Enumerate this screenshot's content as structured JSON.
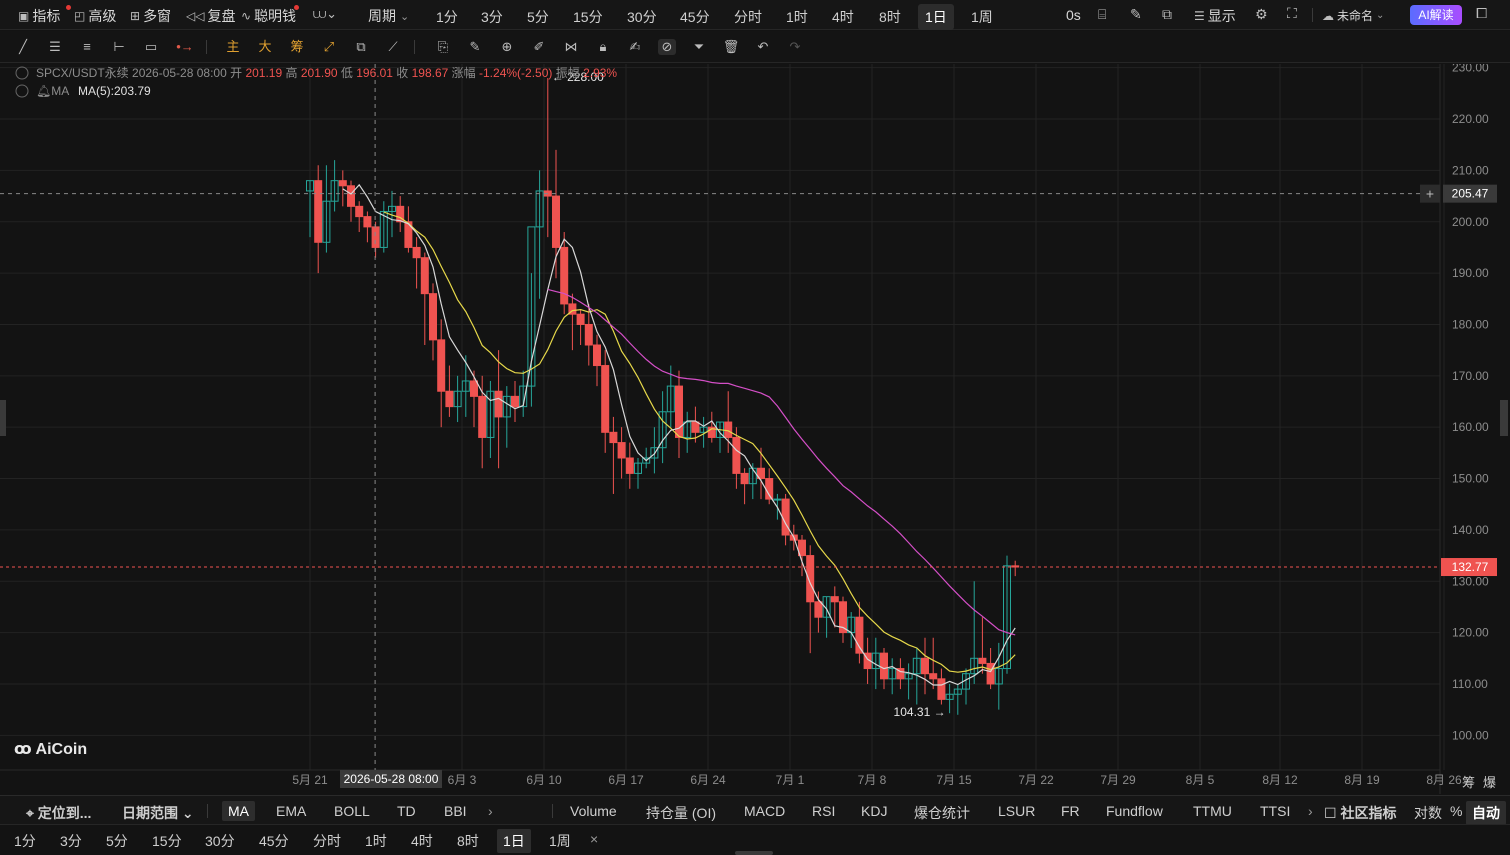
{
  "topbar": {
    "items": [
      {
        "icon": "indicator-icon",
        "label": "指标",
        "x": 18
      },
      {
        "icon": "advanced-icon",
        "label": "高级",
        "x": 74
      },
      {
        "icon": "multiwindow-icon",
        "label": "多窗",
        "x": 130
      },
      {
        "icon": "replay-icon",
        "label": "复盘",
        "x": 186
      },
      {
        "icon": "smart-money-icon",
        "label": "聪明钱",
        "x": 241
      }
    ],
    "period_label": "周期",
    "timeframes": [
      "1分",
      "3分",
      "5分",
      "15分",
      "30分",
      "45分",
      "分时",
      "1时",
      "4时",
      "8时",
      "1日",
      "1周"
    ],
    "active_timeframe": "1日",
    "countdown": "0s",
    "display_label": "显示",
    "layout_name": "未命名",
    "ai_button": "AI解读"
  },
  "drawbar": {
    "text_tools": [
      "主",
      "大",
      "筹"
    ]
  },
  "legend": {
    "symbol": "SPCX/USDT永续",
    "date": "2026-05-28 08:00",
    "open_label": "开",
    "open": "201.19",
    "high_label": "高",
    "high": "201.90",
    "low_label": "低",
    "low": "196.01",
    "close_label": "收",
    "close": "198.67",
    "change_label": "涨幅",
    "change": "-1.24%(-2.50)",
    "amp_label": "振幅",
    "amp": "2.93%",
    "ma_label": "MA",
    "ma_value": "MA(5):203.79"
  },
  "colors": {
    "up": "#26a69a",
    "down": "#ef5350",
    "ma5": "#d8d8d8",
    "ma10": "#e6d84a",
    "ma30": "#d44fc7",
    "bg": "#131313",
    "grid": "#232323"
  },
  "chart_data": {
    "type": "candlestick",
    "ylim": [
      95,
      235
    ],
    "y_ticks": [
      "230.00",
      "220.00",
      "210.00",
      "200.00",
      "190.00",
      "180.00",
      "170.00",
      "160.00",
      "150.00",
      "140.00",
      "130.00",
      "120.00",
      "110.00",
      "100.00"
    ],
    "x_ticks": [
      "5月 21",
      "6月 3",
      "6月 10",
      "6月 17",
      "6月 24",
      "7月 1",
      "7月 8",
      "7月 15",
      "7月 22",
      "7月 29",
      "8月 5",
      "8月 12",
      "8月 19",
      "8月 26"
    ],
    "crosshair_date": "2026-05-28 08:00",
    "crosshair_price": "205.47",
    "last_price": "132.77",
    "max_label": "228.00",
    "min_label": "104.31",
    "watermark": "AiCoin",
    "right_corner": [
      "筹",
      "爆"
    ],
    "candles": [
      [
        206,
        208,
        197,
        208
      ],
      [
        208,
        211,
        190,
        196
      ],
      [
        196,
        211,
        194,
        204
      ],
      [
        204,
        212,
        202,
        208
      ],
      [
        208,
        210,
        203,
        207
      ],
      [
        207,
        208,
        200,
        203
      ],
      [
        203,
        204,
        198,
        201
      ],
      [
        201,
        202,
        196,
        199
      ],
      [
        199,
        200,
        193,
        195
      ],
      [
        195,
        204,
        194,
        202
      ],
      [
        202,
        206,
        197,
        203
      ],
      [
        203,
        205,
        198,
        200
      ],
      [
        200,
        203,
        194,
        195
      ],
      [
        195,
        197,
        187,
        193
      ],
      [
        193,
        194,
        176,
        186
      ],
      [
        186,
        188,
        173,
        177
      ],
      [
        177,
        181,
        160,
        167
      ],
      [
        167,
        172,
        162,
        164
      ],
      [
        164,
        170,
        161,
        167
      ],
      [
        167,
        174,
        162,
        169
      ],
      [
        169,
        171,
        160,
        166
      ],
      [
        166,
        170,
        152,
        158
      ],
      [
        158,
        169,
        154,
        167
      ],
      [
        167,
        175,
        152,
        162
      ],
      [
        162,
        168,
        156,
        166
      ],
      [
        166,
        169,
        161,
        164
      ],
      [
        164,
        171,
        162,
        168
      ],
      [
        168,
        190,
        164,
        199
      ],
      [
        199,
        210,
        185,
        206
      ],
      [
        206,
        228,
        197,
        205
      ],
      [
        205,
        214,
        189,
        195
      ],
      [
        195,
        198,
        182,
        184
      ],
      [
        184,
        186,
        175,
        182
      ],
      [
        182,
        183,
        176,
        180
      ],
      [
        180,
        184,
        172,
        176
      ],
      [
        176,
        178,
        168,
        172
      ],
      [
        172,
        175,
        155,
        159
      ],
      [
        159,
        162,
        147,
        157
      ],
      [
        157,
        160,
        150,
        154
      ],
      [
        154,
        157,
        148,
        151
      ],
      [
        151,
        154,
        148,
        153
      ],
      [
        153,
        156,
        152,
        154
      ],
      [
        154,
        160,
        151,
        156
      ],
      [
        156,
        167,
        153,
        163
      ],
      [
        163,
        172,
        160,
        168
      ],
      [
        168,
        171,
        154,
        158
      ],
      [
        158,
        163,
        155,
        161
      ],
      [
        161,
        164,
        157,
        159
      ],
      [
        159,
        162,
        156,
        160
      ],
      [
        160,
        163,
        157,
        158
      ],
      [
        158,
        161,
        155,
        161
      ],
      [
        161,
        167,
        155,
        158
      ],
      [
        158,
        160,
        148,
        151
      ],
      [
        151,
        152,
        145,
        149
      ],
      [
        149,
        153,
        146,
        152
      ],
      [
        152,
        156,
        146,
        150
      ],
      [
        150,
        152,
        145,
        146
      ],
      [
        146,
        147,
        142,
        146
      ],
      [
        146,
        147,
        137,
        139
      ],
      [
        139,
        141,
        136,
        138
      ],
      [
        138,
        139,
        131,
        135
      ],
      [
        135,
        137,
        116,
        126
      ],
      [
        126,
        128,
        120,
        123
      ],
      [
        123,
        127,
        119,
        127
      ],
      [
        127,
        129,
        121,
        126
      ],
      [
        126,
        127,
        118,
        120
      ],
      [
        120,
        124,
        117,
        123
      ],
      [
        123,
        126,
        114,
        116
      ],
      [
        116,
        119,
        110,
        113
      ],
      [
        113,
        119,
        109,
        116
      ],
      [
        116,
        117,
        109,
        111
      ],
      [
        111,
        115,
        108,
        113
      ],
      [
        113,
        115,
        109,
        111
      ],
      [
        111,
        114,
        107,
        112
      ],
      [
        112,
        117,
        106,
        115
      ],
      [
        115,
        119,
        108,
        112
      ],
      [
        112,
        119,
        109,
        111
      ],
      [
        111,
        113,
        106,
        107
      ],
      [
        107,
        110,
        104.31,
        108
      ],
      [
        108,
        110,
        104,
        109
      ],
      [
        109,
        113,
        106,
        112
      ],
      [
        112,
        130,
        110,
        115
      ],
      [
        115,
        123,
        112,
        114
      ],
      [
        114,
        117,
        109,
        110
      ],
      [
        110,
        118,
        105,
        113
      ],
      [
        113,
        135,
        112,
        133
      ],
      [
        133,
        134,
        131,
        132.77
      ]
    ],
    "ma5": [
      null,
      null,
      null,
      null,
      206.4,
      205.4,
      207.2,
      204.8,
      202,
      201.2,
      200.4,
      200.2,
      199.6,
      197.8,
      195.4,
      191.2,
      184,
      177.6,
      175,
      172.6,
      169.8,
      166.8,
      165.2,
      165.6,
      164.6,
      163.6,
      164.2,
      172.8,
      179.8,
      186.8,
      193.2,
      196.6,
      195,
      190.2,
      183.4,
      178.6,
      175.6,
      171.2,
      164.4,
      158.2,
      155,
      153.5,
      154.8,
      157.4,
      159.4,
      159.8,
      161.2,
      161.2,
      160.2,
      161.2,
      158.9,
      157.3,
      155.5,
      154.4,
      151.8,
      149.6,
      146.8,
      144.4,
      141.2,
      138.6,
      133.8,
      129.6,
      126.4,
      124.6,
      121.3,
      121,
      120,
      117.2,
      114.8,
      113.8,
      113,
      113.4,
      112.4,
      112.2,
      111.7,
      110.9,
      109.8,
      109.8,
      110.5,
      109.9,
      110.8,
      111.6,
      112.8,
      112.4,
      115.2,
      118.5,
      120.9
    ],
    "ma10": [
      null,
      null,
      null,
      null,
      null,
      null,
      null,
      null,
      null,
      201.9,
      201.3,
      200.8,
      199.7,
      198.2,
      197,
      194.6,
      191.3,
      188.2,
      184.8,
      182.5,
      179.4,
      175.9,
      174.5,
      172.7,
      171.4,
      170.6,
      170.5,
      171.3,
      172.3,
      175.1,
      178.7,
      181.4,
      182.7,
      182.9,
      182.4,
      182.9,
      182,
      178.7,
      174.8,
      172.4,
      169.7,
      166.5,
      163.5,
      161.2,
      159.8,
      158.2,
      157.7,
      157.9,
      158.7,
      159.7,
      159.5,
      159.3,
      158.4,
      157.6,
      156.8,
      154.9,
      152.7,
      150.5,
      148.2,
      145.8,
      142.9,
      139.8,
      136.9,
      134.9,
      133.1,
      130.5,
      127.6,
      124.9,
      123.2,
      121.7,
      120.1,
      119.2,
      118.5,
      117.6,
      117,
      115.5,
      114.6,
      113.8,
      112.5,
      112.3,
      112.5,
      113,
      113.3,
      112.8,
      113.3,
      114.1,
      115.7
    ]
  },
  "indicator_bar": {
    "locate": "定位到...",
    "date_range": "日期范围",
    "main": [
      "MA",
      "EMA",
      "BOLL",
      "TD",
      "BBI"
    ],
    "main_active": "MA",
    "sub": [
      "Volume",
      "持仓量 (OI)",
      "MACD",
      "RSI",
      "KDJ",
      "爆仓统计",
      "LSUR",
      "FR",
      "Fundflow",
      "TTMU",
      "TTSI"
    ],
    "community": "社区指标",
    "log": "对数",
    "pct": "%",
    "auto": "自动"
  },
  "tf_bar": {
    "items": [
      "1分",
      "3分",
      "5分",
      "15分",
      "30分",
      "45分",
      "分时",
      "1时",
      "4时",
      "8时",
      "1日",
      "1周"
    ],
    "active": "1日",
    "close": "×"
  }
}
